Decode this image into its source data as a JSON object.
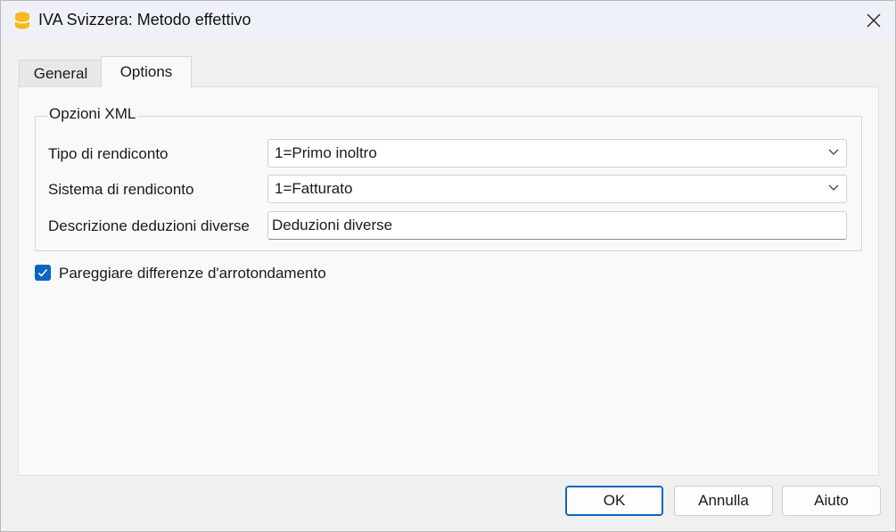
{
  "window": {
    "title": "IVA Svizzera: Metodo effettivo",
    "app_icon": "database-icon",
    "accent_color": "#0a64c2"
  },
  "tabs": [
    {
      "label": "General",
      "active": false
    },
    {
      "label": "Options",
      "active": true
    }
  ],
  "group": {
    "title": "Opzioni XML",
    "rows": [
      {
        "label": "Tipo di rendiconto",
        "type": "select",
        "value": "1=Primo inoltro"
      },
      {
        "label": "Sistema di rendiconto",
        "type": "select",
        "value": "1=Fatturato"
      },
      {
        "label": "Descrizione deduzioni diverse",
        "type": "text",
        "value": "Deduzioni diverse"
      }
    ]
  },
  "checkbox": {
    "label": "Pareggiare differenze d'arrotondamento",
    "checked": true
  },
  "buttons": {
    "ok": "OK",
    "cancel": "Annulla",
    "help": "Aiuto"
  }
}
